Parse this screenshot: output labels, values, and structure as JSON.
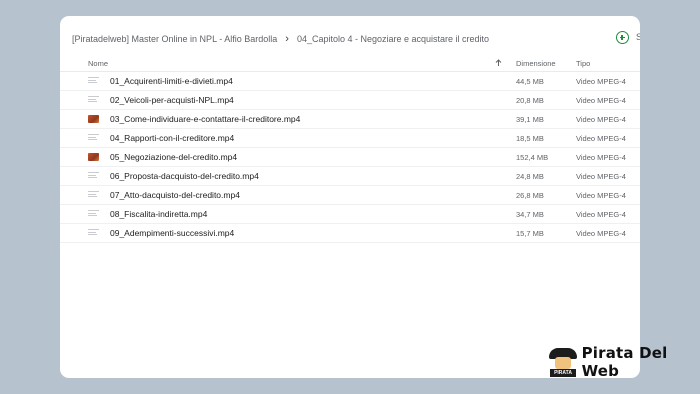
{
  "breadcrumb": {
    "folder": "[Piratadelweb] Master Online in NPL - Alfio Bardolla",
    "subfolder": "04_Capitolo 4 - Negoziare e acquistare il credito"
  },
  "toolbar": {
    "add_label": "S"
  },
  "columns": {
    "name": "Nome",
    "size": "Dimensione",
    "type": "Tipo"
  },
  "files": [
    {
      "name": "01_Acquirenti-limiti-e-divieti.mp4",
      "size": "44,5 MB",
      "type": "Video MPEG-4",
      "icon": "video-file-icon"
    },
    {
      "name": "02_Veicoli-per-acquisti-NPL.mp4",
      "size": "20,8 MB",
      "type": "Video MPEG-4",
      "icon": "video-file-icon"
    },
    {
      "name": "03_Come-individuare-e-contattare-il-creditore.mp4",
      "size": "39,1 MB",
      "type": "Video MPEG-4",
      "icon": "video-thumbnail-icon"
    },
    {
      "name": "04_Rapporti-con-il-creditore.mp4",
      "size": "18,5 MB",
      "type": "Video MPEG-4",
      "icon": "video-file-icon"
    },
    {
      "name": "05_Negoziazione-del-credito.mp4",
      "size": "152,4 MB",
      "type": "Video MPEG-4",
      "icon": "video-thumbnail-icon"
    },
    {
      "name": "06_Proposta-dacquisto-del-credito.mp4",
      "size": "24,8 MB",
      "type": "Video MPEG-4",
      "icon": "video-file-icon"
    },
    {
      "name": "07_Atto-dacquisto-del-credito.mp4",
      "size": "26,8 MB",
      "type": "Video MPEG-4",
      "icon": "video-file-icon"
    },
    {
      "name": "08_Fiscalita-indiretta.mp4",
      "size": "34,7 MB",
      "type": "Video MPEG-4",
      "icon": "video-file-icon"
    },
    {
      "name": "09_Adempimenti-successivi.mp4",
      "size": "15,7 MB",
      "type": "Video MPEG-4",
      "icon": "video-file-icon"
    }
  ],
  "watermark": {
    "brand": "Pirata Del Web",
    "badge": "PIRATA"
  },
  "colors": {
    "background": "#b7c2cf",
    "accent": "#1e8e3e"
  }
}
